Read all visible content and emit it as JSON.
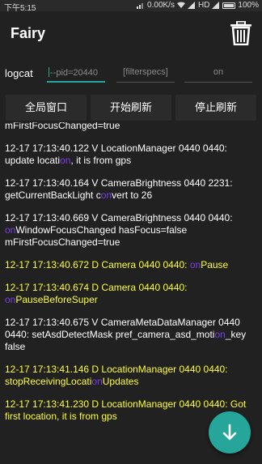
{
  "status_bar": {
    "time": "下午5:15",
    "network_speed": "0.00K/s",
    "network_type": "HD",
    "battery": "100%"
  },
  "app": {
    "title": "Fairy",
    "delete_icon": "trash-icon"
  },
  "filter": {
    "label": "logcat",
    "pid_value": "--pid=20440",
    "specs_placeholder": "[filterspecs]",
    "level_value": "on"
  },
  "buttons": {
    "global_window": "全局窗口",
    "start_refresh": "开始刷新",
    "stop_refresh": "停止刷新"
  },
  "logs": [
    {
      "level": "V",
      "before": "mFirstFocusChanged=true",
      "match": "",
      "after": ""
    },
    {
      "level": "V",
      "before": "12-17 17:13:40.122 V LocationManager 0440 0440: update locati",
      "match": "on",
      "after": ", it is from gps"
    },
    {
      "level": "V",
      "before": "12-17 17:13:40.164 V CameraBrightness 0440 2231: getCurrentBackLight c",
      "match": "on",
      "after": "vert to 26"
    },
    {
      "level": "V",
      "before": "12-17 17:13:40.669 V CameraBrightness 0440 0440: ",
      "match": "on",
      "after": "WindowFocusChanged hasFocus=false mFirstFocusChanged=true"
    },
    {
      "level": "D",
      "before": "12-17 17:13:40.672 D Camera 0440 0440: ",
      "match": "on",
      "after": "Pause"
    },
    {
      "level": "D",
      "before": "12-17 17:13:40.674 D Camera 0440 0440: ",
      "match": "on",
      "after": "PauseBeforeSuper"
    },
    {
      "level": "V",
      "before": "12-17 17:13:40.675 V CameraMetaDataManager 0440 0440: setAsdDetectMask pref_camera_asd_moti",
      "match": "on",
      "after": "_key false"
    },
    {
      "level": "D",
      "before": "12-17 17:13:41.146 D LocationManager 0440 0440: stopReceivingLocati",
      "match": "on",
      "after": "Updates"
    },
    {
      "level": "D",
      "before": "12-17 17:13:41.230 D LocationManager 0440 0440: Got first location, it is from gps",
      "match": "",
      "after": ""
    }
  ],
  "fab": {
    "icon": "arrow-down-icon",
    "color": "#26a69a"
  },
  "colors": {
    "verbose": "#ffffff",
    "debug": "#ffff33",
    "highlight": "#7b3fe4",
    "accent": "#26a69a"
  }
}
